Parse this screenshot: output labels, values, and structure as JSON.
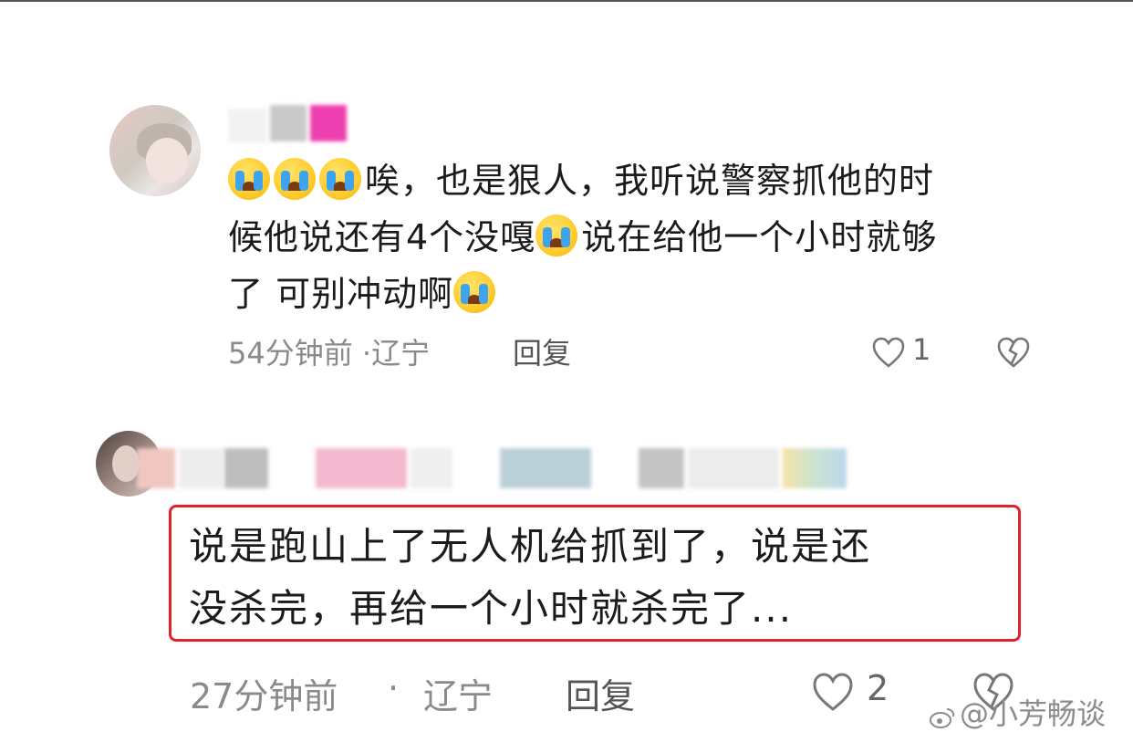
{
  "comments": [
    {
      "author_avatar": "avatar",
      "text_lines": [
        "唉，也是狠人，我听说警察抓他的时",
        "候他说还有4个没嘎",
        "说在给他一个小时就够",
        "了 可别冲动啊"
      ],
      "emoji": "loudly-crying-face",
      "time": "54分钟前",
      "separator": "·",
      "location": "辽宁",
      "reply_label": "回复",
      "like_count": "1"
    },
    {
      "author_avatar": "avatar",
      "text_lines": [
        "说是跑山上了无人机给抓到了，说是还",
        "没杀完，再给一个小时就杀完了..."
      ],
      "time": "27分钟前",
      "separator": "·",
      "location": "辽宁",
      "reply_label": "回复",
      "like_count": "2",
      "highlight_color": "#e0222a"
    }
  ],
  "watermark": {
    "text": "@小芳畅谈",
    "icon": "weibo-icon"
  }
}
